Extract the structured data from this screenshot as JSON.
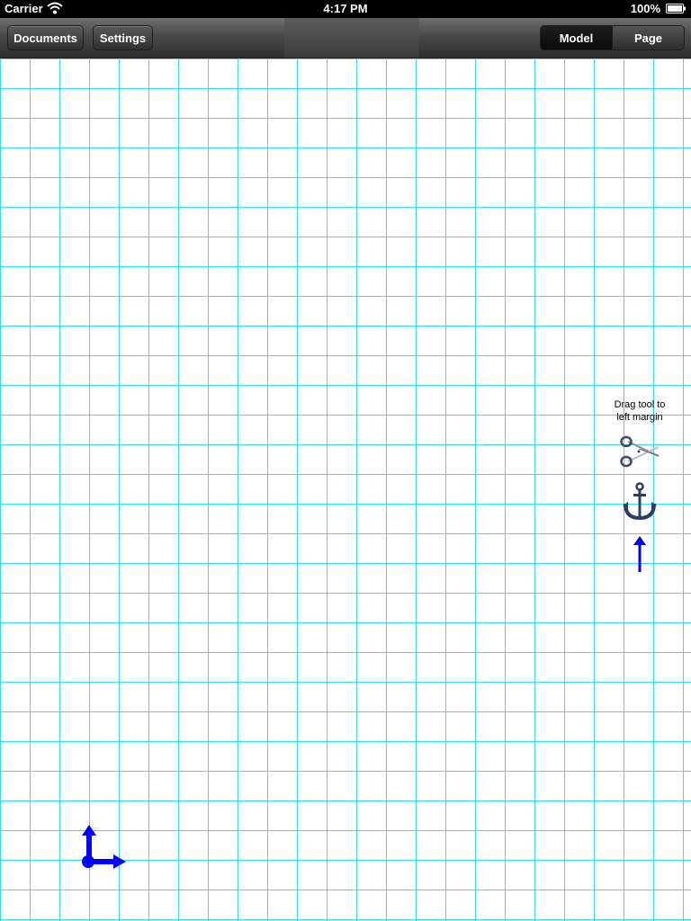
{
  "status_bar": {
    "carrier": "Carrier",
    "time": "4:17 PM",
    "battery": "100%"
  },
  "toolbar": {
    "documents_label": "Documents",
    "settings_label": "Settings",
    "segments": [
      {
        "label": "Model",
        "selected": true
      },
      {
        "label": "Page",
        "selected": false
      }
    ]
  },
  "canvas": {
    "grid_color": "#33dfe8",
    "tool_hint": "Drag tool to left margin",
    "tools": [
      {
        "name": "scissors-icon"
      },
      {
        "name": "anchor-icon"
      },
      {
        "name": "arrow-up-icon"
      }
    ],
    "origin_marker": "axes-icon"
  },
  "colors": {
    "toolbar_dark": "#2d2d2d",
    "axis_blue": "#0000ff",
    "anchor_navy": "#2b3f66"
  }
}
